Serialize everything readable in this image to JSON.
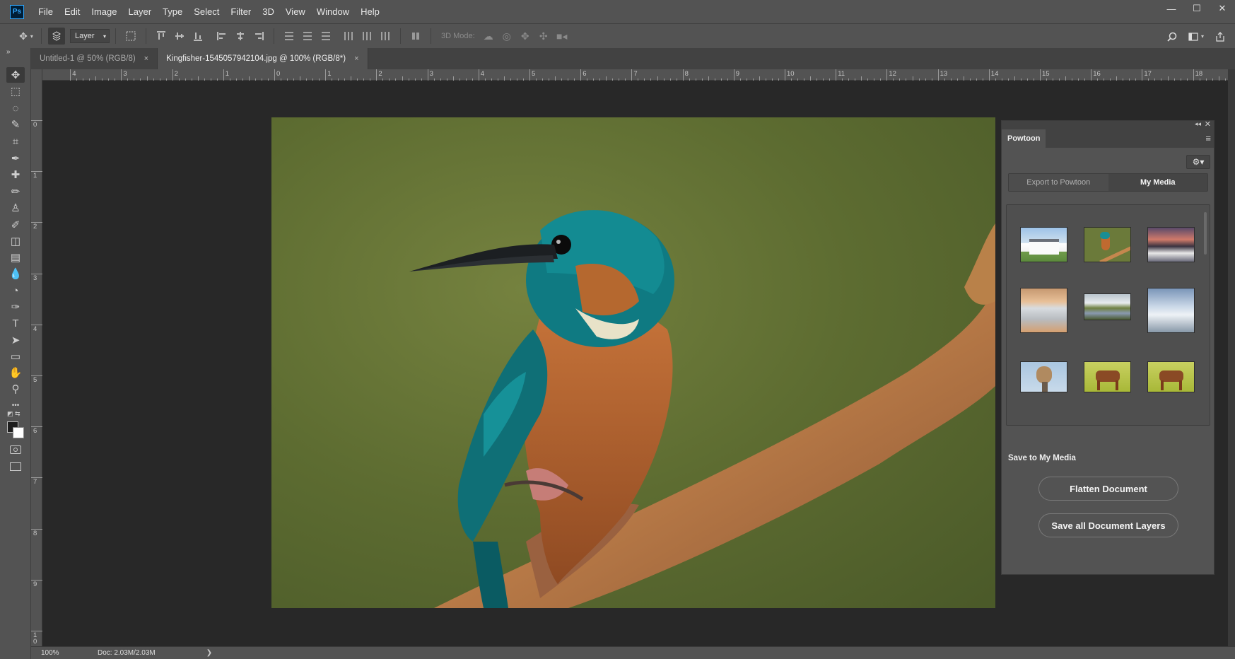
{
  "app": {
    "logo": "Ps"
  },
  "menu": [
    "File",
    "Edit",
    "Image",
    "Layer",
    "Type",
    "Select",
    "Filter",
    "3D",
    "View",
    "Window",
    "Help"
  ],
  "window_controls": {
    "minimize": "—",
    "maximize": "☐",
    "close": "✕"
  },
  "options": {
    "layer_select": "Layer",
    "mode_3d": "3D Mode:"
  },
  "tabs": [
    {
      "label": "Untitled-1 @ 50% (RGB/8)",
      "close": "×"
    },
    {
      "label": "Kingfisher-1545057942104.jpg @ 100% (RGB/8*)",
      "close": "×"
    }
  ],
  "ruler_top": [
    "4",
    "3",
    "2",
    "1",
    "0",
    "1",
    "2",
    "3",
    "4",
    "5",
    "6",
    "7",
    "8",
    "9",
    "10",
    "11",
    "12",
    "13",
    "14",
    "15",
    "16",
    "17",
    "18"
  ],
  "ruler_left": [
    "0",
    "1",
    "2",
    "3",
    "4",
    "5",
    "6",
    "7",
    "8",
    "9",
    "1 0"
  ],
  "status": {
    "zoom": "100%",
    "doc": "Doc: 2.03M/2.03M",
    "arrow": "❯"
  },
  "panel": {
    "tab": "Powtoon",
    "collapse": "◂◂",
    "close": "✕",
    "menu": "≡",
    "gear": "⚙▾",
    "segment": [
      "Export to Powtoon",
      "My Media"
    ],
    "save_label": "Save to My Media",
    "flatten_button": "Flatten Document",
    "save_layers_button": "Save all Document Layers",
    "thumbnails": [
      "house",
      "kingfisher",
      "sunset-village",
      "caravan",
      "lake-valley",
      "snowy-mountains",
      "owl",
      "horse",
      "horse"
    ]
  },
  "tools": [
    "move-tool-icon",
    "marquee-tool-icon",
    "lasso-tool-icon",
    "quick-select-tool-icon",
    "crop-tool-icon",
    "eyedropper-tool-icon",
    "healing-brush-tool-icon",
    "brush-tool-icon",
    "stamp-tool-icon",
    "history-brush-tool-icon",
    "eraser-tool-icon",
    "gradient-tool-icon",
    "blur-tool-icon",
    "dodge-tool-icon",
    "pen-tool-icon",
    "type-tool-icon",
    "path-select-tool-icon",
    "rectangle-tool-icon",
    "hand-tool-icon",
    "zoom-tool-icon",
    "more-tools-icon"
  ],
  "tool_glyphs": [
    "✥",
    "⬚",
    "◌",
    "✎",
    "⌗",
    "✒",
    "✚",
    "✏",
    "♙",
    "✐",
    "◫",
    "▤",
    "💧",
    "◔",
    "✑",
    "T",
    "➤",
    "▭",
    "✋",
    "⚲",
    "•••"
  ]
}
